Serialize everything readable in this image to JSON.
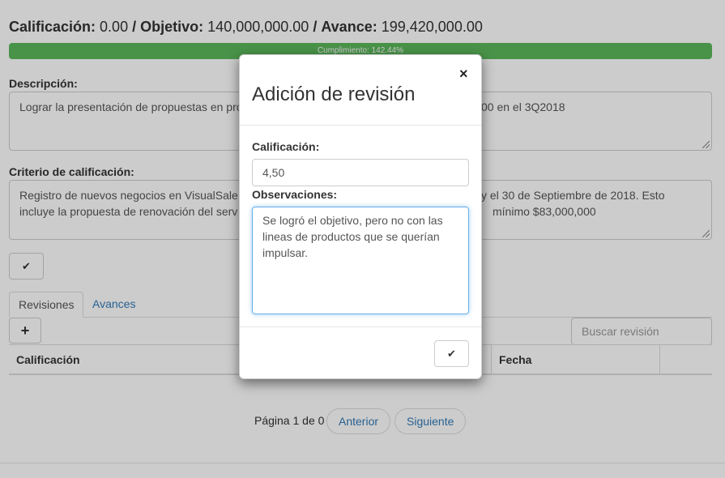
{
  "summary": {
    "score_label": "Calificación:",
    "score_value": "0.00",
    "target_label": "Objetivo:",
    "target_value": "140,000,000.00",
    "advance_label": "Avance:",
    "advance_value": "199,420,000.00",
    "separator": "/"
  },
  "progress": {
    "label": "Cumplimiento: 142.44%",
    "percent": 142.44,
    "color": "#5cb85c"
  },
  "description": {
    "label": "Descripción:",
    "text_start": "Lograr la presentación de propuestas en pro",
    "text_end": "00 en el 3Q2018"
  },
  "criteria": {
    "label": "Criterio de calificación:",
    "line1_start": "Registro de nuevos negocios en VisualSale",
    "line1_end": "y el 30 de Septiembre de 2018. Esto",
    "line2_start": "incluye la propuesta de renovación del serv",
    "line2_end": "mínimo $83,000,000"
  },
  "confirm_button": {
    "icon": "check-icon",
    "glyph": "✔"
  },
  "tabs": [
    {
      "label": "Revisiones"
    },
    {
      "label": "Avances"
    }
  ],
  "add_button": {
    "icon": "plus-icon",
    "glyph": "+"
  },
  "search": {
    "placeholder": "Buscar revisión"
  },
  "table": {
    "columns": [
      "Calificación",
      "Fecha"
    ]
  },
  "pager": {
    "label": "Página 1 de 0",
    "prev": "Anterior",
    "next": "Siguiente"
  },
  "modal": {
    "title": "Adición de revisión",
    "close_glyph": "×",
    "score_label": "Calificación:",
    "score_value": "4,50",
    "notes_label": "Observaciones:",
    "notes_value": "Se logró el objetivo, pero no con las lineas de productos que se querían impulsar.",
    "save_glyph": "✔"
  },
  "colors": {
    "link": "#337ab7",
    "focus_border": "#66afe9"
  }
}
